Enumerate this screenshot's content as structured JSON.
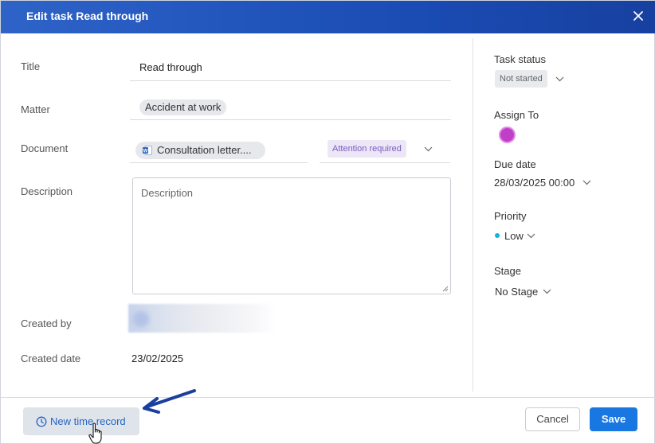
{
  "dialog": {
    "title": "Edit task Read through"
  },
  "form": {
    "title_label": "Title",
    "title_value": "Read through",
    "matter_label": "Matter",
    "matter_value": "Accident at work",
    "document_label": "Document",
    "document_value": "Consultation letter....",
    "document_status": "Attention required",
    "description_label": "Description",
    "description_placeholder": "Description",
    "created_by_label": "Created by",
    "created_date_label": "Created date",
    "created_date_value": "23/02/2025"
  },
  "sidebar": {
    "task_status_label": "Task status",
    "task_status_value": "Not started",
    "assign_to_label": "Assign To",
    "due_date_label": "Due date",
    "due_date_value": "28/03/2025 00:00",
    "priority_label": "Priority",
    "priority_value": "Low",
    "stage_label": "Stage",
    "stage_value": "No Stage"
  },
  "footer": {
    "new_time_record_label": "New time record",
    "cancel_label": "Cancel",
    "save_label": "Save"
  },
  "colors": {
    "header": "#1b4db5",
    "primary_button": "#1877e0",
    "priority_low": "#12b5d6",
    "avatar": "#c13fc8",
    "annotation_arrow": "#1a3f9c"
  },
  "icons": {
    "close": "close-icon",
    "document": "word-document-icon",
    "chevron": "chevron-down-icon",
    "clock": "clock-icon",
    "arrow": "annotation-arrow",
    "cursor": "hand-pointer-icon"
  }
}
